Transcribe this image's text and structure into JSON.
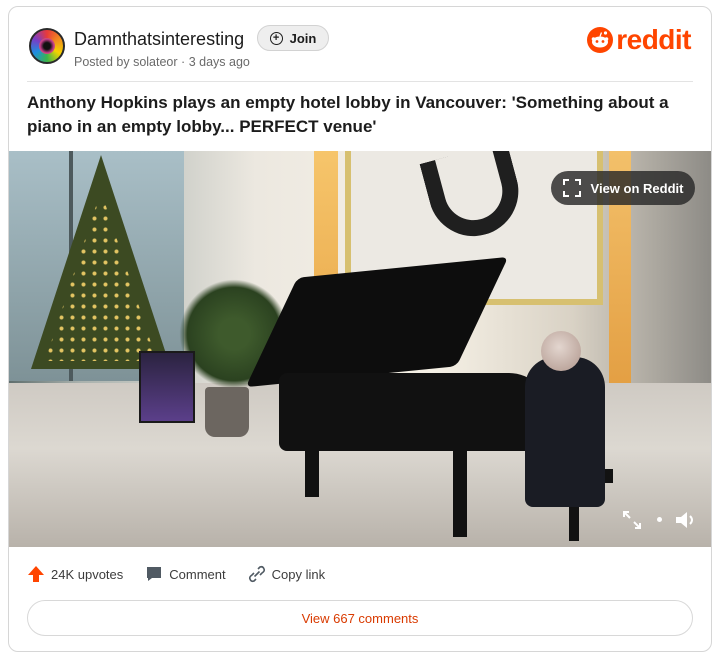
{
  "post": {
    "subreddit": "Damnthatsinteresting",
    "join_label": "Join",
    "posted_prefix": "Posted by",
    "author": "solateor",
    "separator": "·",
    "time_ago": "3 days ago",
    "title": "Anthony Hopkins plays an empty hotel lobby in Vancouver: 'Something about a piano in an empty lobby... PERFECT venue'"
  },
  "brand": {
    "logo_text": "reddit",
    "accent_color": "#ff4500"
  },
  "media": {
    "view_on_label": "View on Reddit"
  },
  "actions": {
    "upvotes": "24K upvotes",
    "comment": "Comment",
    "copy_link": "Copy link",
    "upvote_color": "#ff4500"
  },
  "footer": {
    "view_comments": "View 667 comments"
  },
  "icons": {
    "avatar": "subreddit-avatar",
    "join": "plus-circle-icon",
    "logo": "reddit-snoo-icon",
    "expand": "expand-icon",
    "fullscreen": "fullscreen-icon",
    "volume": "volume-icon",
    "upvote": "upvote-arrow-icon",
    "comment": "comment-bubble-icon",
    "link": "link-icon"
  }
}
